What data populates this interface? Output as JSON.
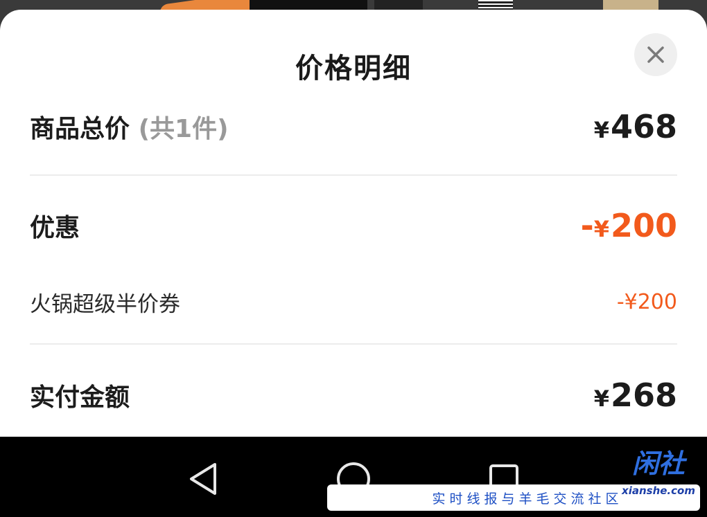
{
  "sheet": {
    "title": "价格明细",
    "close_icon": "close-icon"
  },
  "rows": {
    "total": {
      "label": "商品总价",
      "sublabel": "(共1件)",
      "currency": "¥",
      "amount": "468"
    },
    "discount": {
      "label": "优惠",
      "prefix": "-",
      "currency": "¥",
      "amount": "200"
    },
    "coupon": {
      "label": "火锅超级半价券",
      "value": "-¥200"
    },
    "paid": {
      "label": "实付金额",
      "currency": "¥",
      "amount": "268"
    }
  },
  "navbar": {
    "back_icon": "triangle-back-icon",
    "home_icon": "circle-home-icon",
    "recents_icon": "square-recents-icon"
  },
  "watermark": {
    "logo_text": "闲社",
    "logo_domain": "xianshe.com",
    "tagline": "实时线报与羊毛交流社区"
  },
  "colors": {
    "accent_orange": "#f25a1c",
    "text_dark": "#1c1c1c",
    "watermark_blue": "#2f6fe0"
  }
}
